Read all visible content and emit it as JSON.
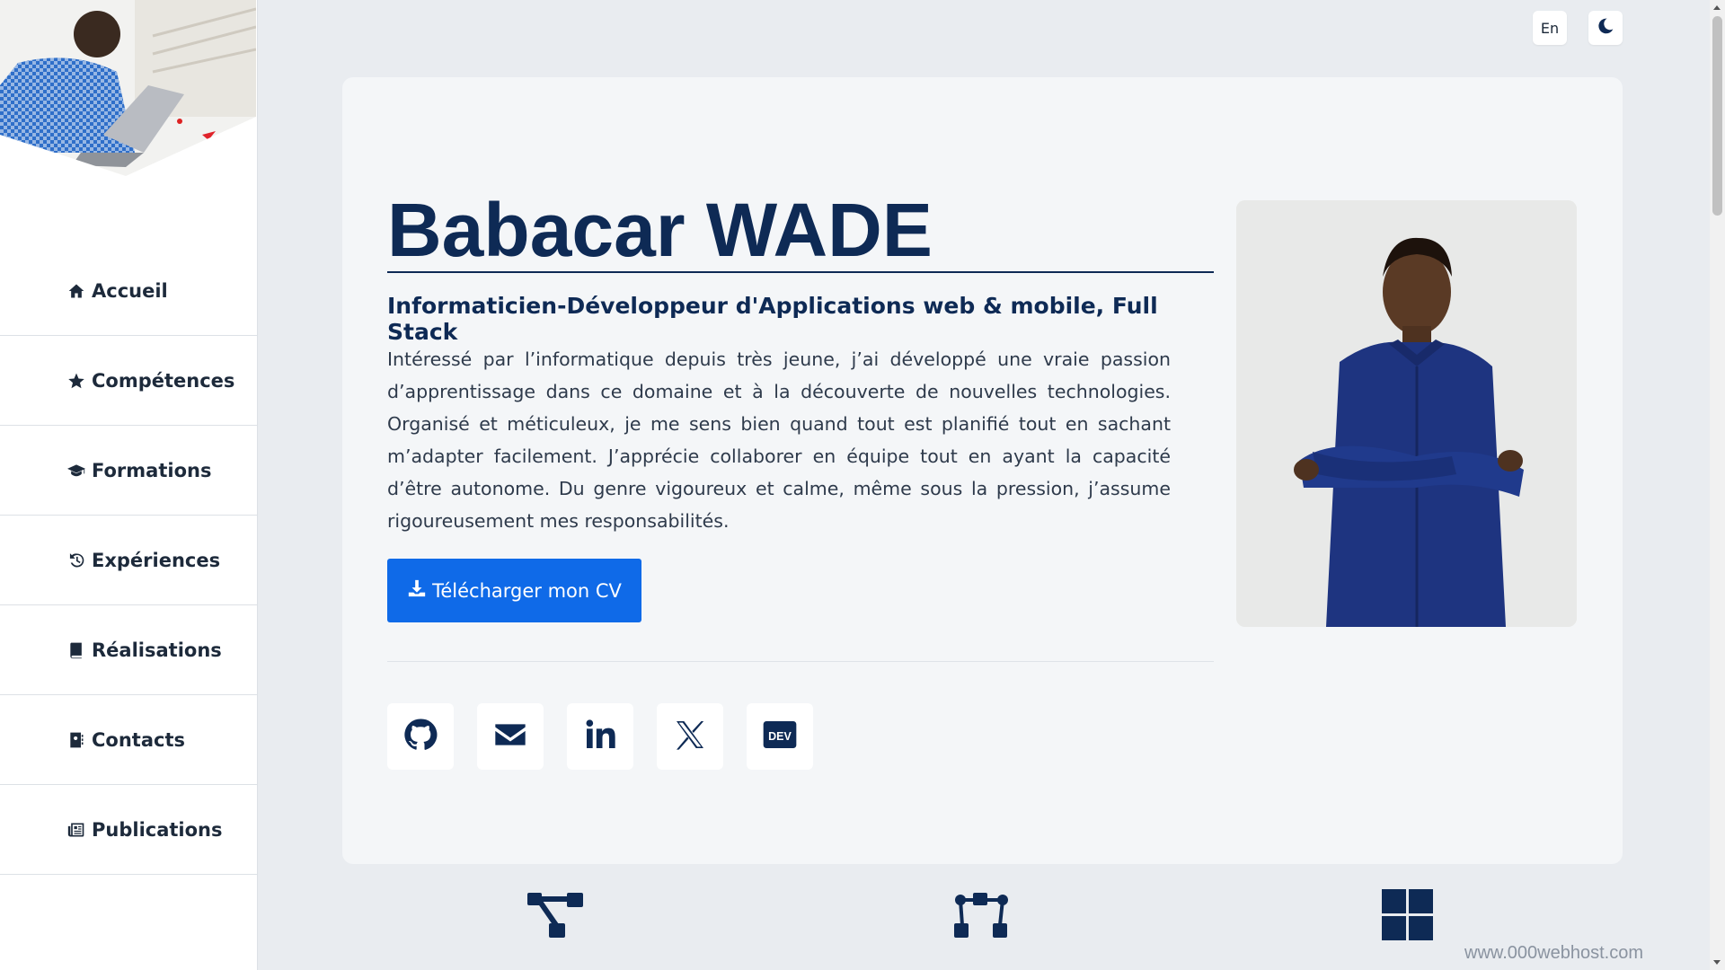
{
  "sidebar": {
    "items": [
      {
        "label": "Accueil",
        "icon": "home-icon"
      },
      {
        "label": "Compétences",
        "icon": "star-icon"
      },
      {
        "label": "Formations",
        "icon": "graduation-cap-icon"
      },
      {
        "label": "Expériences",
        "icon": "history-icon"
      },
      {
        "label": "Réalisations",
        "icon": "book-icon"
      },
      {
        "label": "Contacts",
        "icon": "address-book-icon"
      },
      {
        "label": "Publications",
        "icon": "newspaper-icon"
      }
    ]
  },
  "header": {
    "language_label": "En",
    "theme_icon": "moon-icon"
  },
  "profile": {
    "name": "Babacar WADE",
    "subtitle": "Informaticien-Développeur d'Applications web & mobile, Full Stack",
    "bio": "Intéressé par l’informatique depuis très jeune, j’ai développé une vraie passion d’apprentissage dans ce domaine et à la découverte de nouvelles technologies. Organisé et méticuleux, je me sens bien quand tout est planifié tout en sachant m’adapter facilement. J’apprécie collaborer en équipe tout en ayant la capacité d’être autonome. Du genre vigoureux et calme, même sous la pression, j’assume rigoureusement mes responsabilités.",
    "cv_button": "Télécharger mon CV"
  },
  "socials": [
    "github-icon",
    "email-icon",
    "linkedin-icon",
    "x-twitter-icon",
    "dev-to-icon"
  ],
  "bottom_icons": [
    "sitemap-icon",
    "network-icon",
    "windows-icon"
  ],
  "footer": {
    "host_link": "www.000webhost.com"
  },
  "colors": {
    "primary": "#0e2a55",
    "button": "#0f6ae8",
    "background": "#e9ecf0",
    "card": "#f4f6f8"
  }
}
